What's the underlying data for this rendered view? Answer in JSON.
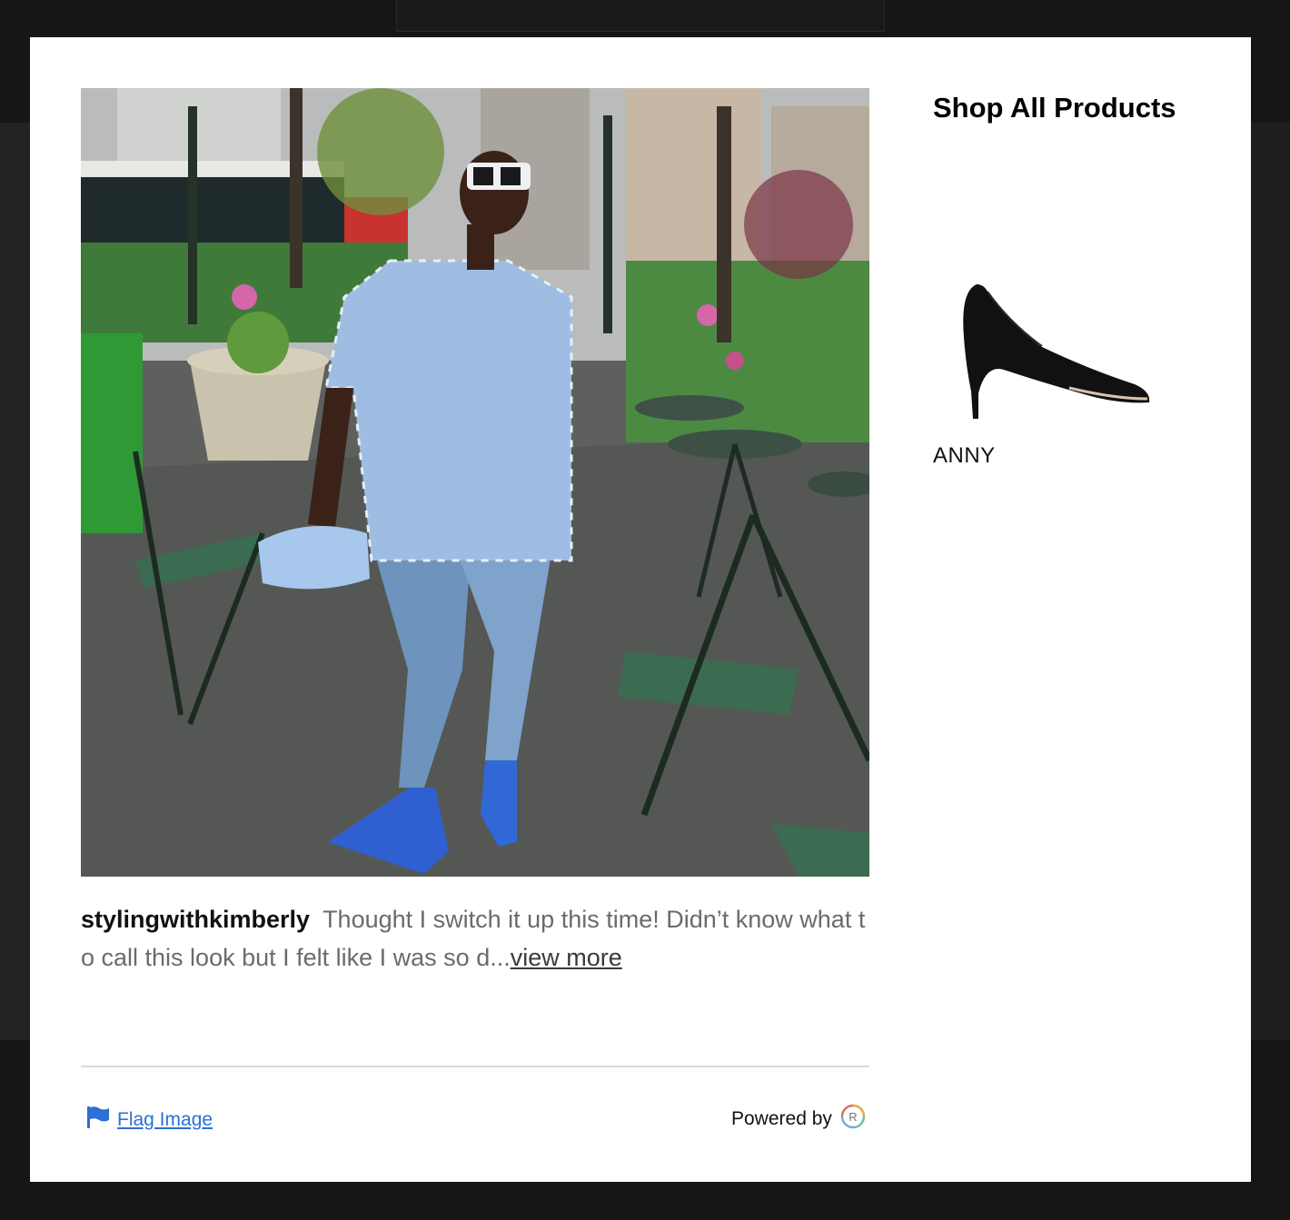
{
  "gallery": {
    "shop_title": "Shop All Products",
    "products": [
      {
        "name": "ANNY",
        "image": "black-suede-pointed-pump-icon"
      }
    ]
  },
  "post": {
    "username": "stylingwithkimberly",
    "caption_text": "Thought I switch it up this time! Didn’t know what to call this look but I felt like I was so d...",
    "view_more_label": "view more",
    "photo": "street-style-photo"
  },
  "footer": {
    "flag_label": "Flag Image",
    "powered_by_label": "Powered by",
    "brand_logo": "R"
  },
  "colors": {
    "link_blue": "#2c6fd6",
    "backdrop": "#161616",
    "modal_bg": "#ffffff"
  }
}
